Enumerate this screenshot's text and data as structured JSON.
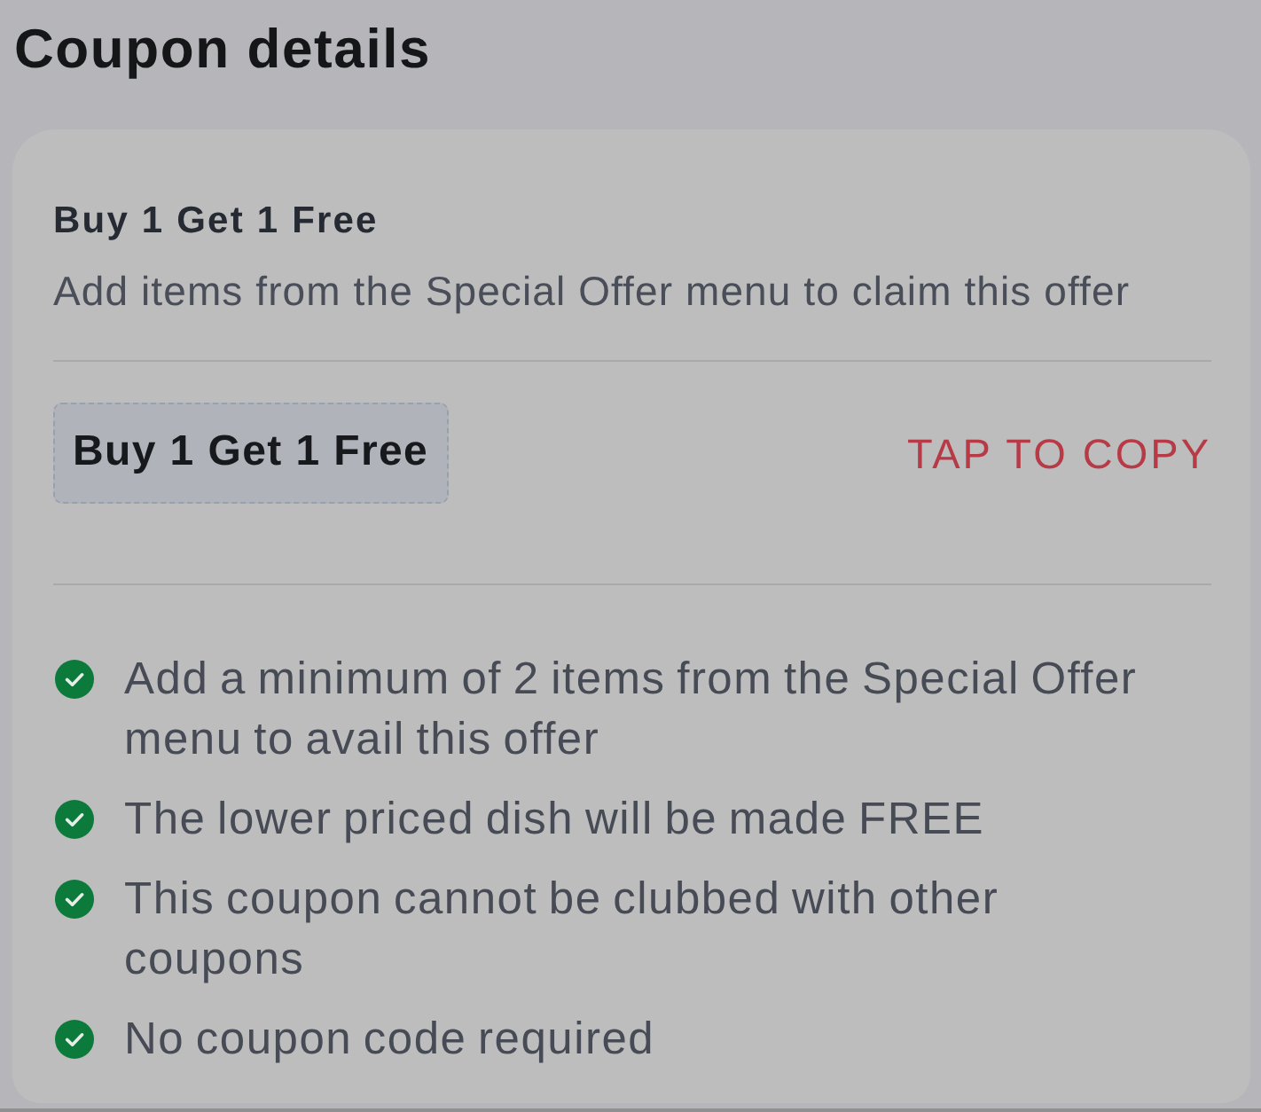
{
  "title": "Coupon details",
  "coupon": {
    "name": "Buy 1 Get 1 Free",
    "description": "Add items from the Special Offer menu to claim this offer",
    "code": "Buy 1 Get 1 Free",
    "copy_action": "TAP TO COPY"
  },
  "terms": [
    "Add a minimum of 2 items from the Special Offer menu to avail this offer",
    "The lower priced dish will be made FREE",
    "This coupon cannot be clubbed with other coupons",
    "No coupon code required"
  ]
}
